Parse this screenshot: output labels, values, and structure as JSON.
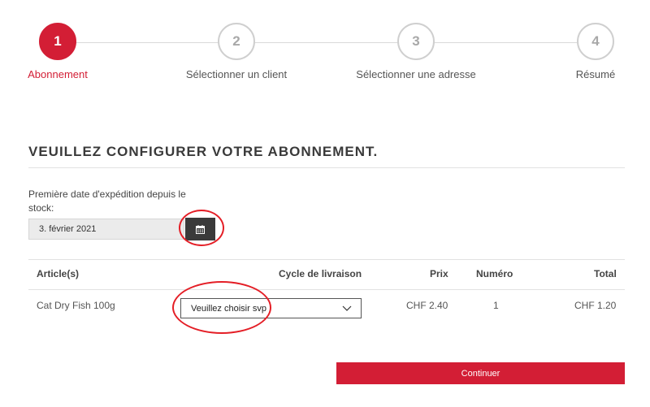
{
  "stepper": {
    "steps": [
      {
        "number": "1",
        "label": "Abonnement",
        "active": true
      },
      {
        "number": "2",
        "label": "Sélectionner un client",
        "active": false
      },
      {
        "number": "3",
        "label": "Sélectionner une adresse",
        "active": false
      },
      {
        "number": "4",
        "label": "Résumé",
        "active": false
      }
    ]
  },
  "page": {
    "heading": "VEUILLEZ CONFIGURER VOTRE ABONNEMENT."
  },
  "shipping_date": {
    "label": "Première date d'expédition depuis le stock:",
    "value": "3. février 2021",
    "calendar_icon": "calendar-icon"
  },
  "table": {
    "headers": {
      "article": "Article(s)",
      "cycle": "Cycle de livraison",
      "price": "Prix",
      "number": "Numéro",
      "total": "Total"
    },
    "rows": [
      {
        "article": "Cat Dry Fish 100g",
        "cycle_placeholder": "Veuillez choisir svp",
        "price": "CHF 2.40",
        "number": "1",
        "total": "CHF 1.20"
      }
    ]
  },
  "actions": {
    "continue_label": "Continuer"
  },
  "colors": {
    "brand_red": "#d31e35",
    "annotation_red": "#e41e26",
    "dark_button": "#3a3a3a"
  }
}
